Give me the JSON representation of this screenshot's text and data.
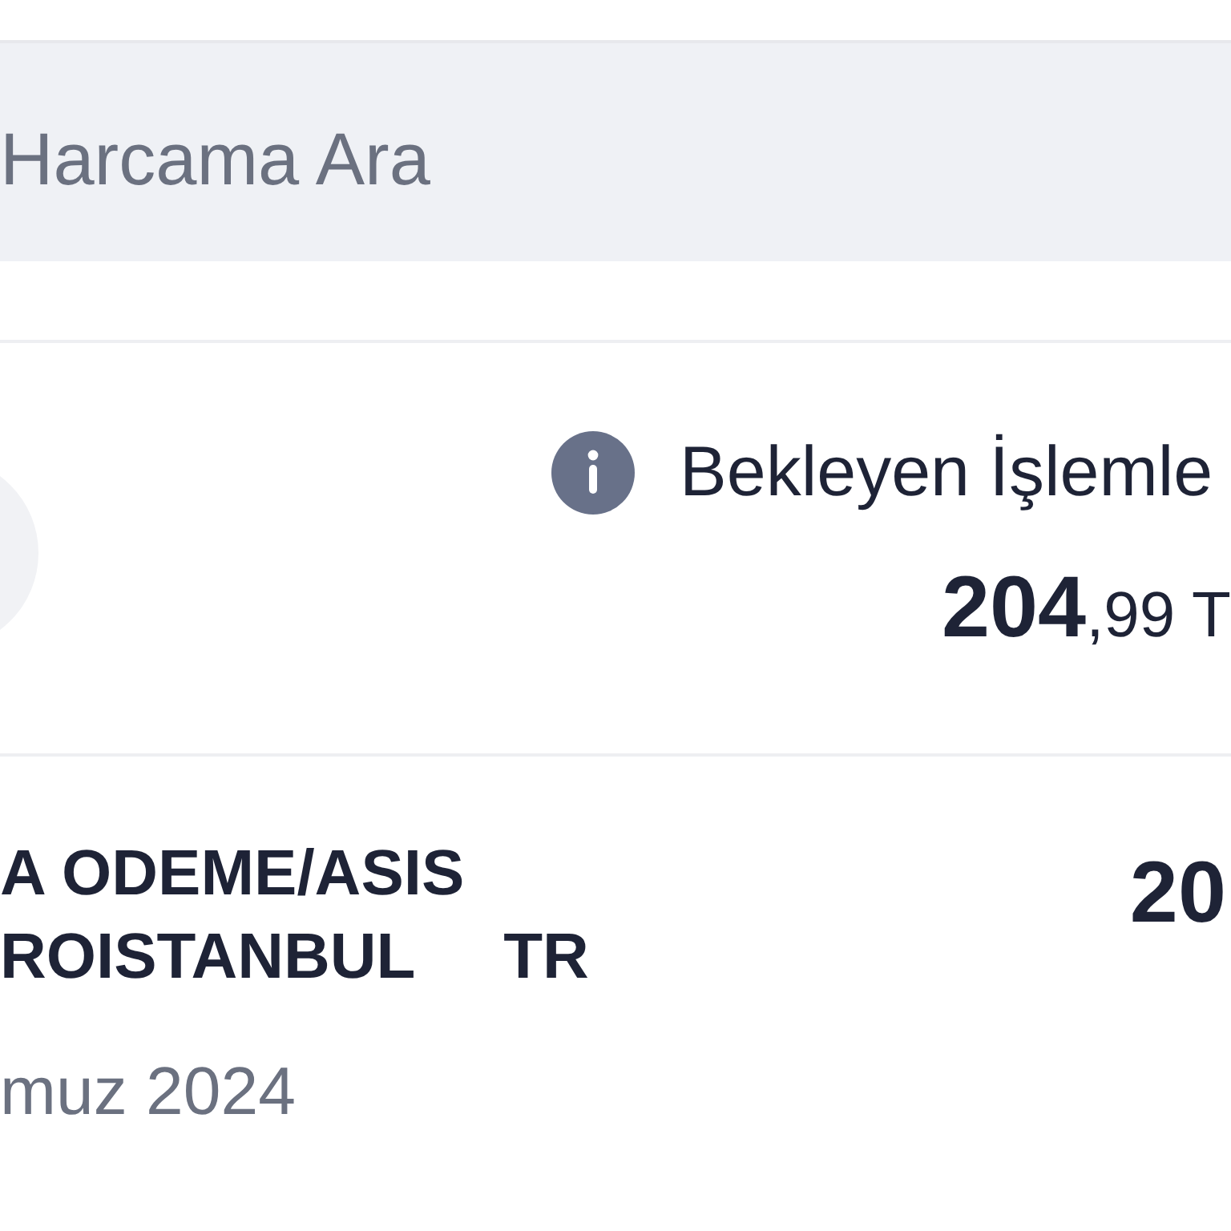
{
  "search": {
    "placeholder": "Harcama Ara"
  },
  "pending": {
    "label": "Bekleyen İşlemle",
    "amount": "**204**,99 T"
  },
  "transactions": [
    {
      "description": "A ODEME/ASIS\nROISTANBUL     TR",
      "date": "muz 2024",
      "amount": "20"
    }
  ]
}
